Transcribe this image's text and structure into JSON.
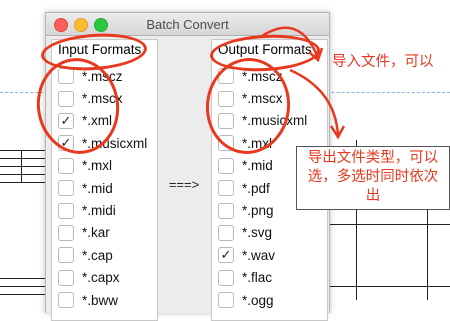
{
  "window": {
    "title": "Batch Convert"
  },
  "input": {
    "header": "Input Formats",
    "items": [
      {
        "label": "*.mscz",
        "checked": false
      },
      {
        "label": "*.mscx",
        "checked": false
      },
      {
        "label": "*.xml",
        "checked": true
      },
      {
        "label": "*.musicxml",
        "checked": true
      },
      {
        "label": "*.mxl",
        "checked": false
      },
      {
        "label": "*.mid",
        "checked": false
      },
      {
        "label": "*.midi",
        "checked": false
      },
      {
        "label": "*.kar",
        "checked": false
      },
      {
        "label": "*.cap",
        "checked": false
      },
      {
        "label": "*.capx",
        "checked": false
      },
      {
        "label": "*.bww",
        "checked": false
      }
    ]
  },
  "arrow_label": "===>",
  "output": {
    "header": "Output Formats",
    "items": [
      {
        "label": "*.mscz",
        "checked": false
      },
      {
        "label": "*.mscx",
        "checked": false
      },
      {
        "label": "*.musicxml",
        "checked": false
      },
      {
        "label": "*.mxl",
        "checked": false
      },
      {
        "label": "*.mid",
        "checked": false
      },
      {
        "label": "*.pdf",
        "checked": false
      },
      {
        "label": "*.png",
        "checked": false
      },
      {
        "label": "*.svg",
        "checked": false
      },
      {
        "label": "*.wav",
        "checked": true
      },
      {
        "label": "*.flac",
        "checked": false
      },
      {
        "label": "*.ogg",
        "checked": false
      }
    ]
  },
  "annotations": {
    "import_note": "导入文件，可以",
    "export_note_lines": [
      "导出文件类型，可以",
      "选，多选时同时依次",
      "出"
    ]
  },
  "colors": {
    "annotation": "#e8391f",
    "checkmark": "#222222"
  },
  "icons": {
    "check": "checkmark-icon"
  }
}
